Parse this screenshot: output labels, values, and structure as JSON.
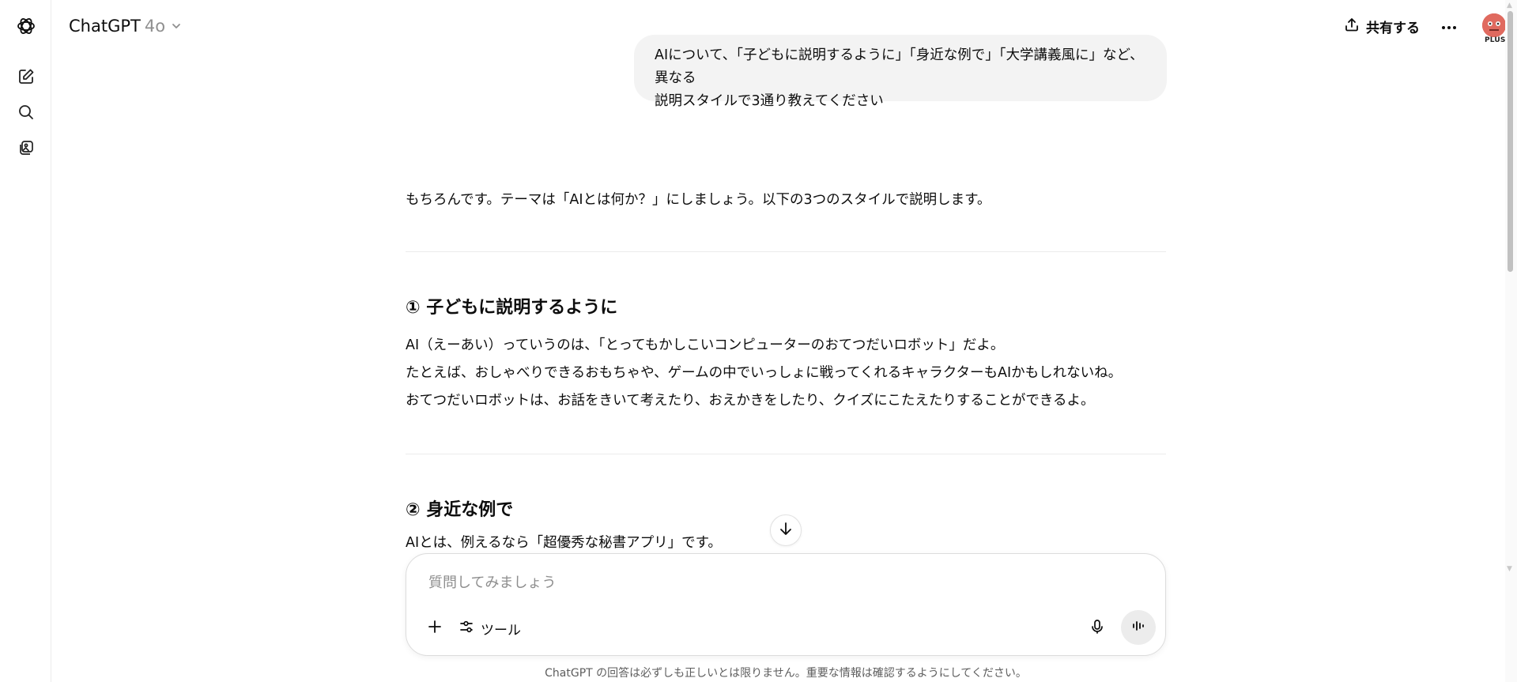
{
  "header": {
    "model_name": "ChatGPT",
    "model_version": "4o",
    "share_label": "共有する",
    "plan_badge": "PLUS"
  },
  "rail": {
    "icons": [
      "openai-logo-icon",
      "new-chat-icon",
      "search-icon",
      "library-icon"
    ]
  },
  "conversation": {
    "user_message_line1": "AIについて、「子どもに説明するように」「身近な例で」「大学講義風に」など、異なる",
    "user_message_line2": "説明スタイルで3通り教えてください",
    "assistant_intro": "もちろんです。テーマは「AIとは何か？」にしましょう。以下の3つのスタイルで説明します。",
    "sections": [
      {
        "heading": "① 子どもに説明するように",
        "paragraphs": [
          "AI（えーあい）っていうのは、「とってもかしこいコンピューターのおてつだいロボット」だよ。",
          "たとえば、おしゃべりできるおもちゃや、ゲームの中でいっしょに戦ってくれるキャラクターもAIかもしれないね。",
          "おてつだいロボットは、お話をきいて考えたり、おえかきをしたり、クイズにこたえたりすることができるよ。"
        ]
      },
      {
        "heading": "② 身近な例で",
        "paragraphs": [
          "AIとは、例えるなら「超優秀な秘書アプリ」です。"
        ]
      }
    ]
  },
  "composer": {
    "placeholder": "質問してみましょう",
    "tools_label": "ツール"
  },
  "footer": {
    "disclaimer": "ChatGPT の回答は必ずしも正しいとは限りません。重要な情報は確認するようにしてください。"
  }
}
